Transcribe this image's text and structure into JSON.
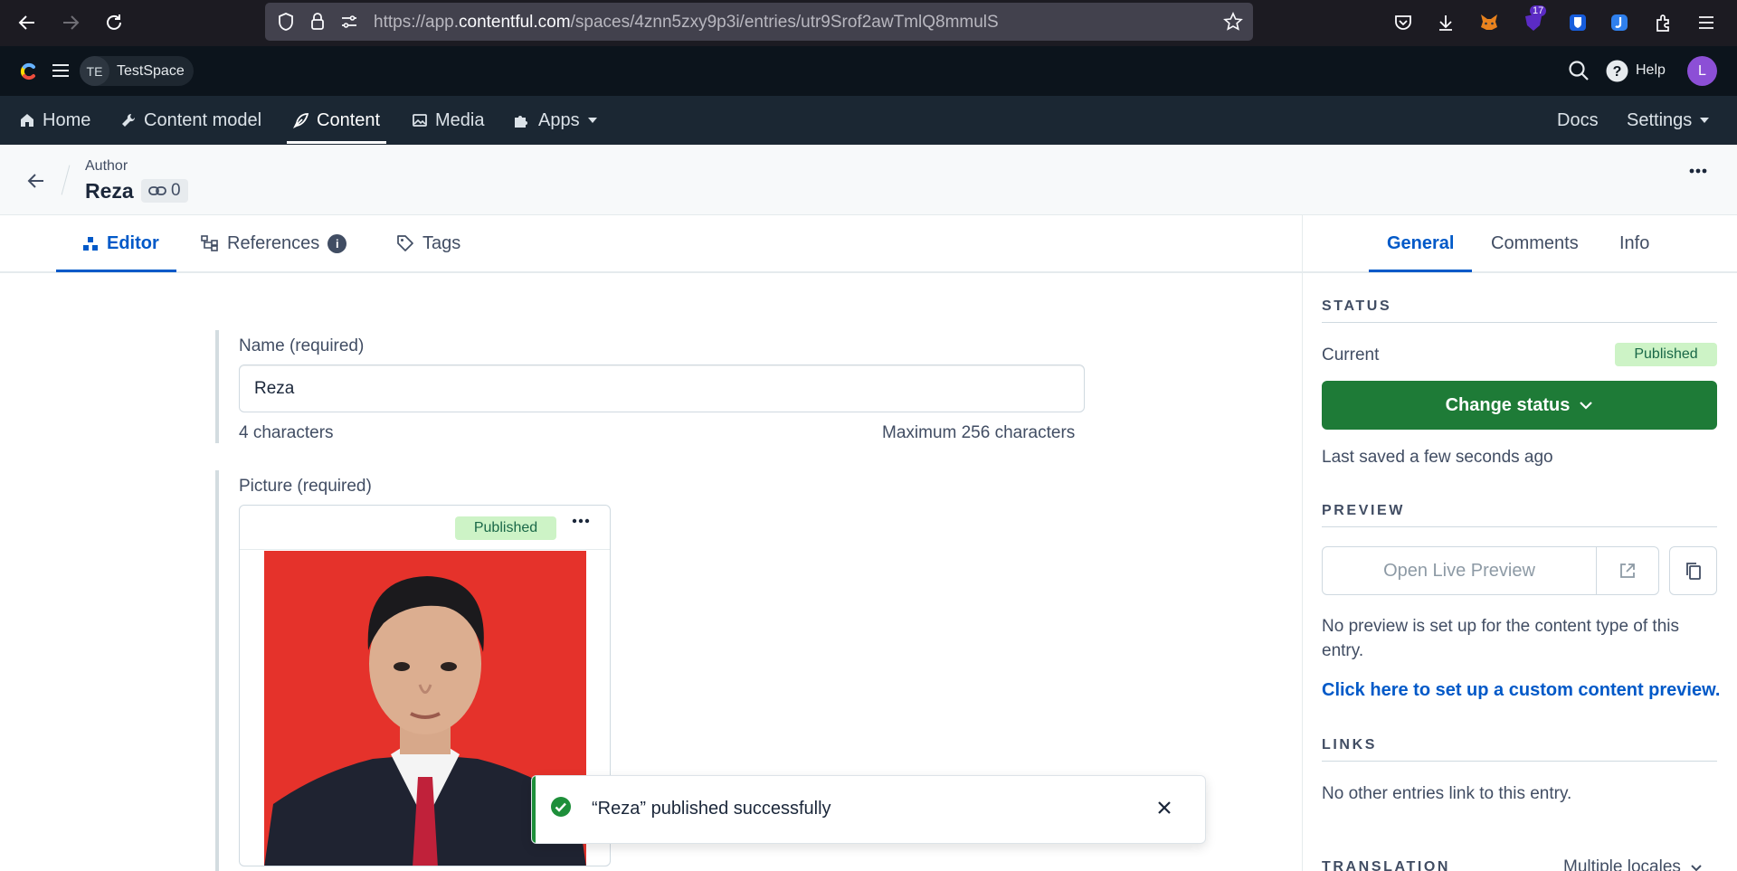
{
  "browser": {
    "url_prefix": "https://app.",
    "url_domain": "contentful.com",
    "url_path": "/spaces/4znn5zxy9p3i/entries/utr9Srof2awTmlQ8mmulS",
    "extension_badge": "17"
  },
  "topbar": {
    "space_initials": "TE",
    "space_name": "TestSpace",
    "help_label": "Help",
    "avatar_initial": "L"
  },
  "nav": {
    "home": "Home",
    "content_model": "Content model",
    "content": "Content",
    "media": "Media",
    "apps": "Apps",
    "docs": "Docs",
    "settings": "Settings"
  },
  "entry": {
    "content_type": "Author",
    "title": "Reza",
    "link_count": "0"
  },
  "editor_tabs": {
    "editor": "Editor",
    "references": "References",
    "references_info": "i",
    "tags": "Tags"
  },
  "fields": {
    "name_label": "Name (required)",
    "name_value": "Reza",
    "char_count": "4 characters",
    "char_max": "Maximum 256 characters",
    "picture_label": "Picture (required)",
    "picture_status": "Published"
  },
  "toast": {
    "message": "“Reza” published successfully"
  },
  "sidebar": {
    "tabs": {
      "general": "General",
      "comments": "Comments",
      "info": "Info"
    },
    "status_heading": "STATUS",
    "current_label": "Current",
    "current_status": "Published",
    "change_status": "Change status",
    "last_saved": "Last saved a few seconds ago",
    "preview_heading": "PREVIEW",
    "open_live_preview": "Open Live Preview",
    "no_preview": "No preview is set up for the content type of this entry.",
    "preview_link": "Click here to set up a custom content preview.",
    "links_heading": "LINKS",
    "no_links": "No other entries link to this entry.",
    "translation_heading": "TRANSLATION",
    "locales": "Multiple locales"
  },
  "colors": {
    "accent": "#0059c8",
    "primary_button": "#1e7b37",
    "published_badge_bg": "#cdf3c6",
    "published_badge_text": "#1a6848",
    "nav_bg": "#1b2733",
    "topbar_bg": "#0c141c"
  }
}
